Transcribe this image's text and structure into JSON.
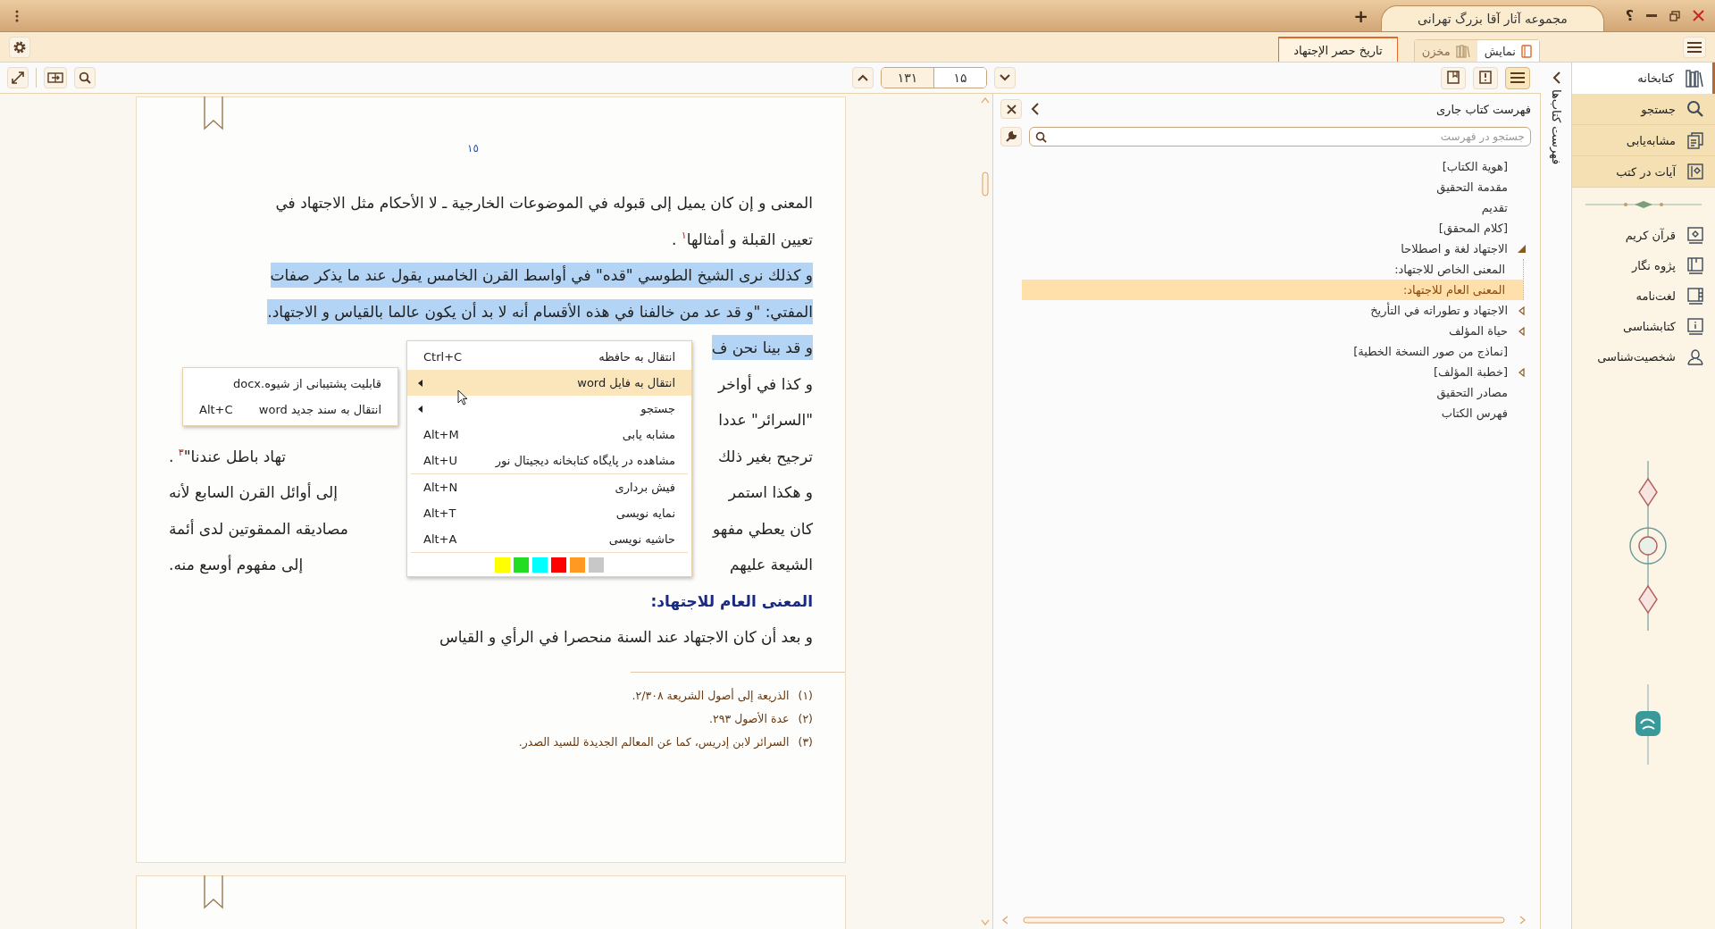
{
  "title_bar": {
    "tabs": [
      {
        "label": "مجموعه آثار آقا بزرگ تهرانی",
        "selected": true
      }
    ],
    "new_tab": "+",
    "help": "؟"
  },
  "ribbon": {
    "document_tab": "تاريخ حصر الإجتهاد",
    "mode_tabs": [
      {
        "label": "نمایش",
        "selected": true
      },
      {
        "label": "مخزن",
        "selected": false
      }
    ]
  },
  "toolbar": {
    "total_pages": "۱۳۱",
    "current_page": "۱۵",
    "view_buttons": [
      {
        "selected": false
      },
      {
        "selected": false
      },
      {
        "selected": true
      }
    ]
  },
  "document": {
    "page_number": "١٥",
    "lines": [
      {
        "kind": "text",
        "highlighted": false,
        "right": "المعنى و إن كان يميل إلى قبوله في الموضوعات الخارجية ـ لا الأحكام مثل الاجتهاد في"
      },
      {
        "kind": "text",
        "highlighted": false,
        "right": "تعيين القبلة و أمثالها$^{١}$ ."
      },
      {
        "kind": "text",
        "highlighted": true,
        "right": "و كذلك نرى الشيخ الطوسي \"قده\" في أواسط القرن الخامس يقول عند ما يذكر صفات"
      },
      {
        "kind": "text",
        "highlighted": true,
        "right": "المفتي: \"و قد عد من خالفنا في هذه الأقسام أنه لا بد أن يكون عالما بالقياس و الاجتهاد."
      },
      {
        "kind": "text",
        "highlighted": true,
        "right": "و قد بينا نحن ف"
      },
      {
        "kind": "text",
        "highlighted": false,
        "right": "و كذا في أواخر"
      },
      {
        "kind": "text",
        "highlighted": false,
        "right": "\"السرائر\" عددا"
      },
      {
        "kind": "text",
        "highlighted": false,
        "right": "ترجيح بغير ذلك",
        "left": "تهاد باطل عندنا\"$^{٣}$ ."
      },
      {
        "kind": "text",
        "highlighted": false,
        "right": "و هكذا استمر",
        "left": "إلى أوائل القرن السابع لأنه"
      },
      {
        "kind": "text",
        "highlighted": false,
        "right": "كان يعطي مفهو",
        "left": "مصاديقه الممقوتين لدى أئمة"
      },
      {
        "kind": "text",
        "highlighted": false,
        "right": "الشيعة عليهم",
        "left": "إلى مفهوم أوسع منه."
      },
      {
        "kind": "heading",
        "highlighted": false,
        "right": "المعنى العام للاجتهاد:"
      },
      {
        "kind": "text",
        "highlighted": false,
        "right": "و بعد أن كان الاجتهاد عند السنة منحصرا في الرأي و القياس"
      }
    ],
    "footnotes": [
      {
        "mark": "(١)",
        "text": "الذريعة إلى أصول الشريعة ٢/٣٠٨."
      },
      {
        "mark": "(٢)",
        "text": "عدة الأصول ٢٩٣."
      },
      {
        "mark": "(٣)",
        "text": "السرائر لابن إدريس، كما عن المعالم الجديدة للسيد الصدر."
      }
    ]
  },
  "context_menu": {
    "groups": [
      {
        "items": [
          {
            "label": "انتقال به حافظه",
            "shortcut": "Ctrl+C",
            "submenu": false,
            "selected": false
          },
          {
            "label": "انتقال به فایل word",
            "submenu": true,
            "selected": true
          },
          {
            "label": "جستجو",
            "submenu": true,
            "selected": false
          },
          {
            "label": "مشابه یابی",
            "shortcut": "Alt+M",
            "submenu": false,
            "selected": false
          },
          {
            "label": "مشاهده در پایگاه کتابخانه دیجیتال نور",
            "shortcut": "Alt+U",
            "submenu": false,
            "selected": false
          }
        ]
      },
      {
        "items": [
          {
            "label": "فیش برداری",
            "shortcut": "Alt+N",
            "submenu": false,
            "selected": false
          },
          {
            "label": "نمایه نویسی",
            "shortcut": "Alt+T",
            "submenu": false,
            "selected": false
          },
          {
            "label": "حاشیه نویسی",
            "shortcut": "Alt+A",
            "submenu": false,
            "selected": false
          }
        ]
      }
    ],
    "colors": [
      {
        "color": "#ffff00"
      },
      {
        "color": "#22dd22"
      },
      {
        "color": "#00ffff"
      },
      {
        "color": "#ff0000"
      },
      {
        "color": "#ff9922"
      },
      {
        "color": "#c8c8c8"
      }
    ]
  },
  "submenu": {
    "items": [
      {
        "label": "قابلیت پشتیبانی از شیوه.docx"
      },
      {
        "label": "انتقال به سند جدید word",
        "shortcut": "Alt+C"
      }
    ]
  },
  "contents_panel": {
    "title": "فهرست کتاب جاری",
    "search": {
      "placeholder": "جستجو در فهرست"
    },
    "tree": [
      {
        "label": "[هوية الكتاب]",
        "selected": false
      },
      {
        "label": "مقدمة التحقيق",
        "selected": false
      },
      {
        "label": "تقديم",
        "selected": false
      },
      {
        "label": "[كلام المحقق]",
        "selected": false
      },
      {
        "label": "الاجتهاد لغة و اصطلاحا",
        "expanded": true,
        "selected": false,
        "children": [
          {
            "label": "المعنى الخاص للاجتهاد:",
            "selected": false
          },
          {
            "label": "المعنى العام للاجتهاد:",
            "selected": true
          }
        ]
      },
      {
        "label": "الاجتهاد و تطوراته في التأريخ",
        "expanded": false,
        "selected": false
      },
      {
        "label": "حياة المؤلف",
        "expanded": false,
        "selected": false
      },
      {
        "label": "[نماذج من صور النسخة الخطية]",
        "selected": false
      },
      {
        "label": "[خطبة المؤلف]",
        "expanded": false,
        "selected": false
      },
      {
        "label": "مصادر التحقيق",
        "selected": false
      },
      {
        "label": "فهرس الكتاب",
        "selected": false
      }
    ]
  },
  "side_tab": {
    "label": "فهرست کتاب‌ها"
  },
  "sidebar": {
    "groups": [
      {
        "kind": "main",
        "items": [
          {
            "label": "کتابخانه",
            "selected": true
          }
        ]
      },
      {
        "kind": "tools",
        "items": [
          {
            "label": "جستجو",
            "selected": false
          },
          {
            "label": "مشابه‌یابی",
            "selected": false
          },
          {
            "label": "آیات در کتب",
            "selected": false
          }
        ]
      },
      {
        "kind": "books",
        "items": [
          {
            "label": "قرآن کریم",
            "selected": false
          },
          {
            "label": "پژوه نگار",
            "selected": false
          },
          {
            "label": "لغت‌نامه",
            "selected": false
          },
          {
            "label": "کتابشناسی",
            "selected": false
          },
          {
            "label": "شخصیت‌شناسی",
            "selected": false
          }
        ]
      }
    ]
  }
}
